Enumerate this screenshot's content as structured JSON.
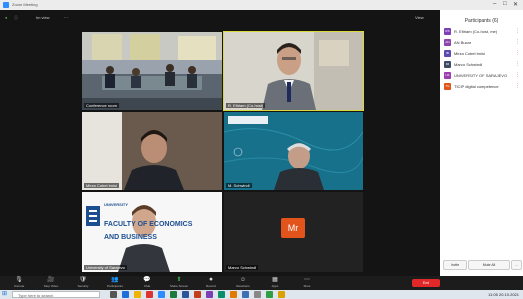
{
  "window": {
    "title": "Zoom Meeting",
    "controls": [
      "–",
      "□",
      "✕"
    ]
  },
  "topbar": {
    "left_label": "Im view",
    "view_label": "View"
  },
  "participants_panel": {
    "title": "Participants (6)",
    "participants": [
      {
        "initials": "RS",
        "name": "R. Eltriam (Co-host, me)",
        "color": "#7b3fb7"
      },
      {
        "initials": "AN",
        "name": "AN Bucar",
        "color": "#8e44ad"
      },
      {
        "initials": "IB",
        "name": "Mirza Cobet bnisi",
        "color": "#5b4bb0"
      },
      {
        "initials": "MI",
        "name": "Marco Schwindl",
        "color": "#3e4a63"
      },
      {
        "initials": "UK",
        "name": "UNIVERSITY OF SARAJEVO",
        "color": "#9b3fb0"
      },
      {
        "initials": "TG",
        "name": "TICIP digital competence",
        "color": "#e2541b"
      }
    ],
    "footer_buttons": [
      "Invite",
      "Mute All",
      "..."
    ]
  },
  "tiles": [
    {
      "id": "room",
      "name": "Conference room"
    },
    {
      "id": "host",
      "name": "R. Eltriam (Co-host)"
    },
    {
      "id": "person2",
      "name": "Mirza Cobet bnisi"
    },
    {
      "id": "person3",
      "name": "M. Schwindl"
    },
    {
      "id": "person4",
      "name": "University of Sarajevo"
    },
    {
      "id": "mr",
      "name": "Marco Schwindl",
      "initials": "Mr"
    }
  ],
  "slide_text": {
    "line1": "UNIVERSITY",
    "line2": "FACULTY OF ECONOMICS",
    "line3": "AND BUSINESS"
  },
  "controls": {
    "buttons": [
      {
        "icon": "🎙",
        "label": "Unmute"
      },
      {
        "icon": "🎥",
        "label": "Stop Video"
      },
      {
        "icon": "🛡",
        "label": "Security"
      },
      {
        "icon": "👥",
        "label": "Participants"
      },
      {
        "icon": "💬",
        "label": "Chat"
      },
      {
        "icon": "⬆",
        "label": "Share Screen"
      },
      {
        "icon": "⏺",
        "label": "Record"
      },
      {
        "icon": "☺",
        "label": "Reactions"
      },
      {
        "icon": "▦",
        "label": "Apps"
      },
      {
        "icon": "⋯",
        "label": "More"
      }
    ],
    "end_label": "End"
  },
  "taskbar": {
    "search_placeholder": "Type here to search",
    "time": "11:05",
    "date": "20.10.2021"
  }
}
